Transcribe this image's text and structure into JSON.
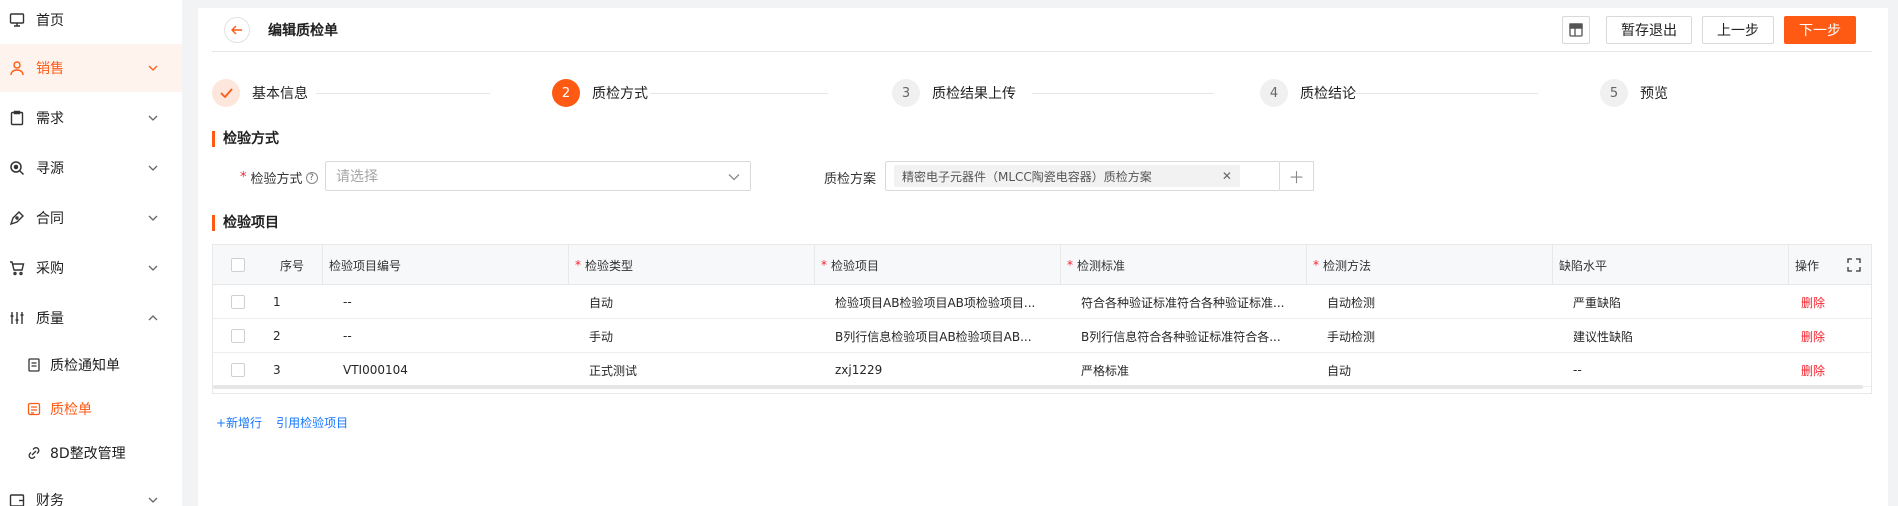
{
  "sidebar": {
    "items": [
      {
        "label": "首页",
        "icon": "monitor-icon"
      },
      {
        "label": "销售",
        "icon": "user-icon"
      },
      {
        "label": "需求",
        "icon": "clipboard-icon"
      },
      {
        "label": "寻源",
        "icon": "search-icon"
      },
      {
        "label": "合同",
        "icon": "pen-icon"
      },
      {
        "label": "采购",
        "icon": "cart-icon"
      },
      {
        "label": "质量",
        "icon": "sliders-icon"
      },
      {
        "label": "财务",
        "icon": "wallet-icon"
      }
    ],
    "sub_items": [
      {
        "label": "质检通知单",
        "icon": "document-icon"
      },
      {
        "label": "质检单",
        "icon": "checklist-icon"
      },
      {
        "label": "8D整改管理",
        "icon": "link-icon"
      }
    ]
  },
  "header": {
    "title": "编辑质检单",
    "save_exit": "暂存退出",
    "prev": "上一步",
    "next": "下一步"
  },
  "steps": [
    {
      "num": "",
      "label": "基本信息",
      "state": "done"
    },
    {
      "num": "2",
      "label": "质检方式",
      "state": "current"
    },
    {
      "num": "3",
      "label": "质检结果上传",
      "state": "todo"
    },
    {
      "num": "4",
      "label": "质检结论",
      "state": "todo"
    },
    {
      "num": "5",
      "label": "预览",
      "state": "todo"
    }
  ],
  "method_section": {
    "title": "检验方式",
    "method_label": "检验方式",
    "method_placeholder": "请选择",
    "scheme_label": "质检方案",
    "scheme_tag": "精密电子元器件（MLCC陶瓷电容器）质检方案"
  },
  "items_section": {
    "title": "检验项目",
    "columns": [
      "序号",
      "检验项目编号",
      "检验类型",
      "检验项目",
      "检测标准",
      "检测方法",
      "缺陷水平",
      "操作"
    ],
    "rows": [
      {
        "seq": "1",
        "code": "--",
        "type": "自动",
        "item": "检验项目AB检验项目AB项检验项目...",
        "standard": "符合各种验证标准符合各种验证标准...",
        "method": "自动检测",
        "level": "严重缺陷",
        "action": "删除"
      },
      {
        "seq": "2",
        "code": "--",
        "type": "手动",
        "item": "B列行信息检验项目AB检验项目AB...",
        "standard": "B列行信息符合各种验证标准符合各...",
        "method": "手动检测",
        "level": "建议性缺陷",
        "action": "删除"
      },
      {
        "seq": "3",
        "code": "VTI000104",
        "type": "正式测试",
        "item": "zxj1229",
        "standard": "严格标准",
        "method": "自动",
        "level": "--",
        "action": "删除"
      }
    ],
    "add_row": "+新增行",
    "reference": "引用检验项目"
  },
  "colors": {
    "accent": "#ff5a14",
    "danger": "#f5222d",
    "link": "#1677ff"
  }
}
